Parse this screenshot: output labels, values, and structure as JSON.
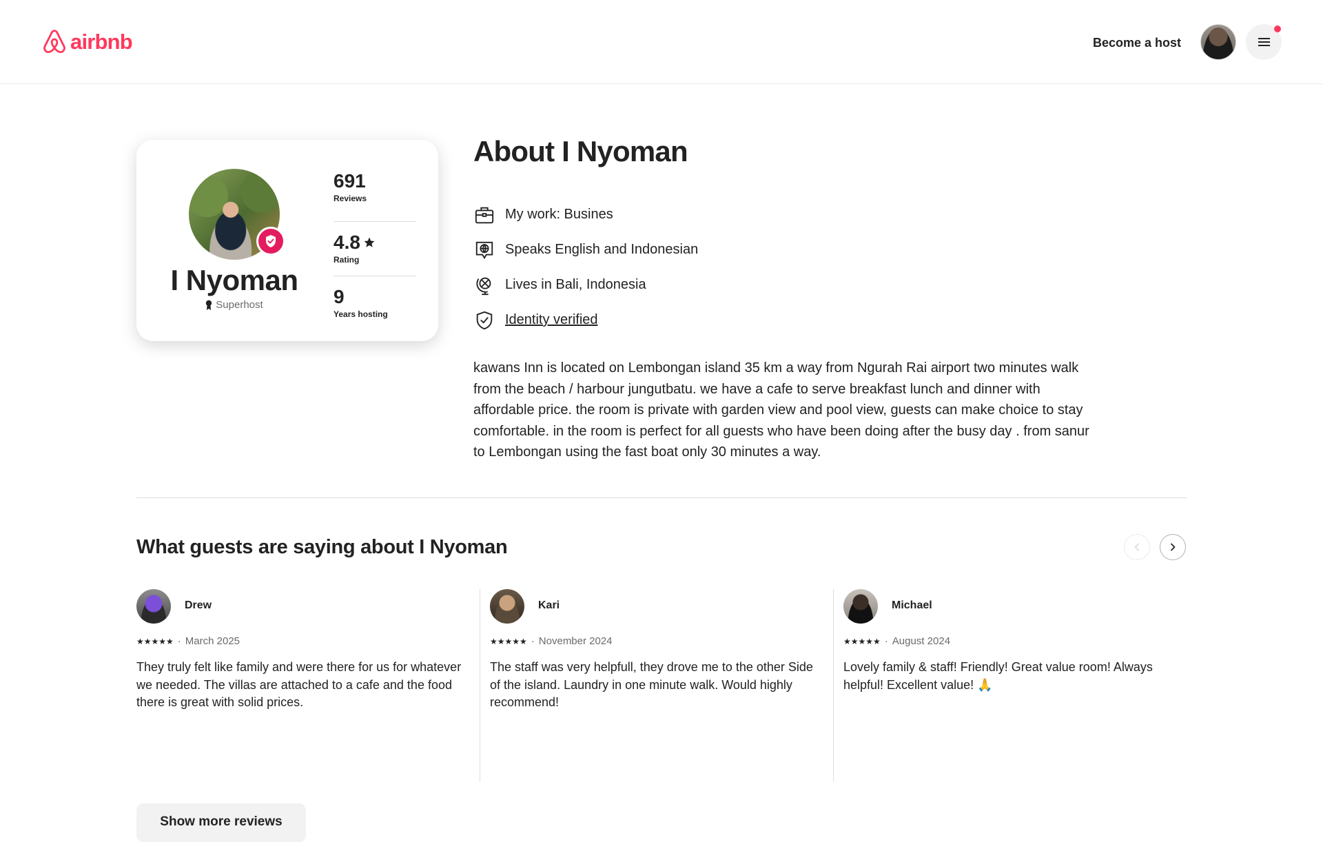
{
  "header": {
    "logo_text": "airbnb",
    "logo_icon": "airbnb-logo-icon",
    "become_host": "Become a host",
    "menu_icon": "hamburger-menu-icon",
    "has_notification": true
  },
  "colors": {
    "brand": "#ff385c",
    "badge": "#e31c5f",
    "text": "#222222",
    "muted": "#6a6a6a",
    "divider": "#dddddd"
  },
  "profile": {
    "name": "I Nyoman",
    "badge": "Superhost",
    "verified_icon": "verified-shield-icon",
    "stats": [
      {
        "value": "691",
        "label": "Reviews"
      },
      {
        "value": "4.8",
        "label": "Rating",
        "icon": "star-icon"
      },
      {
        "value": "9",
        "label": "Years hosting"
      }
    ]
  },
  "about": {
    "title": "About I Nyoman",
    "facts": [
      {
        "icon": "briefcase-icon",
        "text": "My work: Busines"
      },
      {
        "icon": "language-globe-icon",
        "text": "Speaks English and Indonesian"
      },
      {
        "icon": "globe-stand-icon",
        "text": "Lives in Bali, Indonesia"
      },
      {
        "icon": "shield-check-icon",
        "text": "Identity verified"
      }
    ],
    "bio": "kawans Inn is located on Lembongan island 35 km a way from Ngurah Rai airport two minutes walk from the beach / harbour jungutbatu. we have a cafe to serve breakfast lunch and dinner with affordable price. the room is private with garden view and pool view, guests can make choice to stay comfortable. in the room is perfect for all guests who have been doing after the busy day . from sanur to Lembongan using the fast boat only 30 minutes a way."
  },
  "reviews": {
    "title": "What guests are saying about I Nyoman",
    "prev_icon": "chevron-left-icon",
    "next_icon": "chevron-right-icon",
    "items": [
      {
        "name": "Drew",
        "stars": "★★★★★",
        "date": "March 2025",
        "text": "They truly felt like family and were there for us for whatever we needed. The villas are attached to a cafe and the food there is great with solid prices."
      },
      {
        "name": "Kari",
        "stars": "★★★★★",
        "date": "November 2024",
        "text": "The staff was very helpfull, they drove me to the other Side of the island. Laundry in one minute walk. Would highly recommend!"
      },
      {
        "name": "Michael",
        "stars": "★★★★★",
        "date": "August 2024",
        "text": "Lovely family & staff! Friendly! Great value room! Always helpful! Excellent value! 🙏"
      }
    ],
    "show_more": "Show more reviews"
  }
}
